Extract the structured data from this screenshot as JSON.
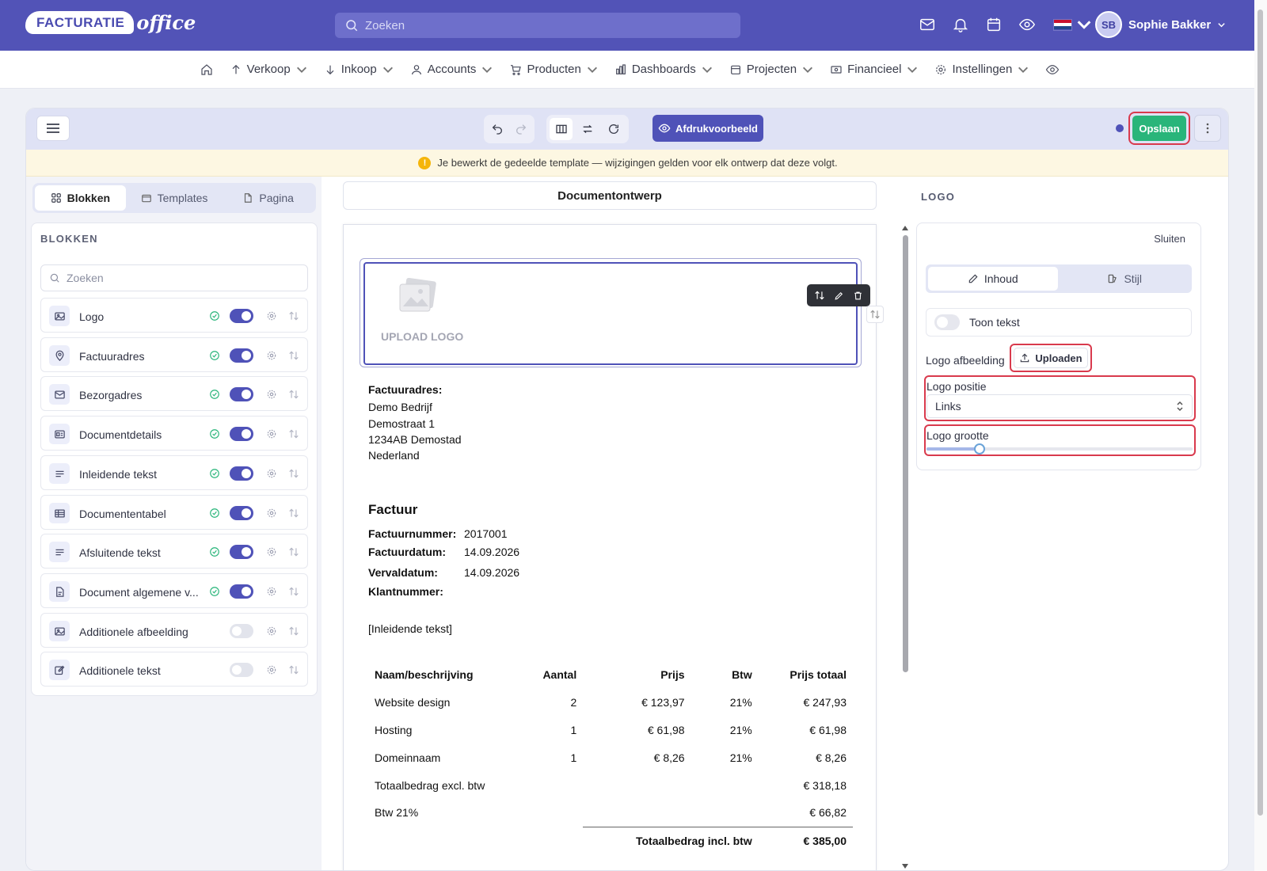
{
  "brand": {
    "logo_word": "FACTURATIE",
    "logo_suffix": "office"
  },
  "topbar": {
    "search_placeholder": "Zoeken",
    "icons": [
      "mail-icon",
      "bell-icon",
      "calendar-icon",
      "eye-icon",
      "flag-nl-icon"
    ],
    "user_initials": "SB",
    "user_name": "Sophie Bakker"
  },
  "nav": {
    "items": [
      {
        "label": "Verkoop",
        "icon": "arrow-up-icon"
      },
      {
        "label": "Inkoop",
        "icon": "arrow-down-icon"
      },
      {
        "label": "Accounts",
        "icon": "user-icon"
      },
      {
        "label": "Producten",
        "icon": "cart-icon"
      },
      {
        "label": "Dashboards",
        "icon": "bar-chart-icon"
      },
      {
        "label": "Projecten",
        "icon": "calendar-icon"
      },
      {
        "label": "Financieel",
        "icon": "money-icon"
      },
      {
        "label": "Instellingen",
        "icon": "gear-icon"
      }
    ]
  },
  "toolbar": {
    "preview_label": "Afdrukvoorbeeld",
    "save_label": "Opslaan"
  },
  "alert": {
    "text": "Je bewerkt de gedeelde template — wijzigingen gelden voor elk ontwerp dat deze volgt."
  },
  "left": {
    "tabs": [
      {
        "label": "Blokken",
        "active": true
      },
      {
        "label": "Templates",
        "active": false
      },
      {
        "label": "Pagina",
        "active": false
      }
    ],
    "panel_title": "BLOKKEN",
    "search_placeholder": "Zoeken",
    "blocks": [
      {
        "label": "Logo",
        "icon": "image-icon",
        "enabled": true
      },
      {
        "label": "Factuuradres",
        "icon": "location-pin-icon",
        "enabled": true
      },
      {
        "label": "Bezorgadres",
        "icon": "mail-icon",
        "enabled": true
      },
      {
        "label": "Documentdetails",
        "icon": "id-card-icon",
        "enabled": true
      },
      {
        "label": "Inleidende tekst",
        "icon": "text-lines-icon",
        "enabled": true
      },
      {
        "label": "Documententabel",
        "icon": "table-icon",
        "enabled": true
      },
      {
        "label": "Afsluitende tekst",
        "icon": "text-lines-icon",
        "enabled": true
      },
      {
        "label": "Document algemene v...",
        "icon": "document-icon",
        "enabled": true
      },
      {
        "label": "Additionele afbeelding",
        "icon": "image-icon",
        "enabled": false
      },
      {
        "label": "Additionele tekst",
        "icon": "edit-icon",
        "enabled": false
      }
    ]
  },
  "canvas": {
    "title": "Documentontwerp",
    "upload_logo": "UPLOAD LOGO",
    "address_title": "Factuuradres:",
    "address_lines": [
      "Demo Bedrijf",
      "Demostraat 1",
      "1234AB Demostad",
      "Nederland"
    ],
    "invoice_title": "Factuur",
    "details": [
      {
        "label": "Factuurnummer:",
        "value": "2017001"
      },
      {
        "label": "Factuurdatum:",
        "value": "14.09.2026"
      },
      {
        "label": "Vervaldatum:",
        "value": "14.09.2026"
      },
      {
        "label": "Klantnummer:",
        "value": ""
      }
    ],
    "intro_text": "[Inleidende tekst]",
    "table": {
      "headers": [
        "Naam/beschrijving",
        "Aantal",
        "Prijs",
        "Btw",
        "Prijs totaal"
      ],
      "rows": [
        [
          "Website design",
          "2",
          "€ 123,97",
          "21%",
          "€ 247,93"
        ],
        [
          "Hosting",
          "1",
          "€ 61,98",
          "21%",
          "€ 61,98"
        ],
        [
          "Domeinnaam",
          "1",
          "€ 8,26",
          "21%",
          "€ 8,26"
        ]
      ],
      "subtotal_label": "Totaalbedrag excl. btw",
      "subtotal_value": "€ 318,18",
      "vat_label": "Btw 21%",
      "vat_value": "€ 66,82",
      "total_label": "Totaalbedrag incl. btw",
      "total_value": "€ 385,00"
    }
  },
  "right": {
    "section_title": "LOGO",
    "close_label": "Sluiten",
    "tabs": [
      {
        "label": "Inhoud",
        "active": true
      },
      {
        "label": "Stijl",
        "active": false
      }
    ],
    "show_text_label": "Toon tekst",
    "logo_image_label": "Logo afbeelding",
    "upload_label": "Uploaden",
    "position_label": "Logo positie",
    "position_value": "Links",
    "size_label": "Logo grootte",
    "size_level": 0.2
  },
  "colors": {
    "primary": "#5253b7",
    "save": "#29b57a",
    "highlight": "#d93a4d",
    "alert_bg": "#fdf7e2"
  }
}
